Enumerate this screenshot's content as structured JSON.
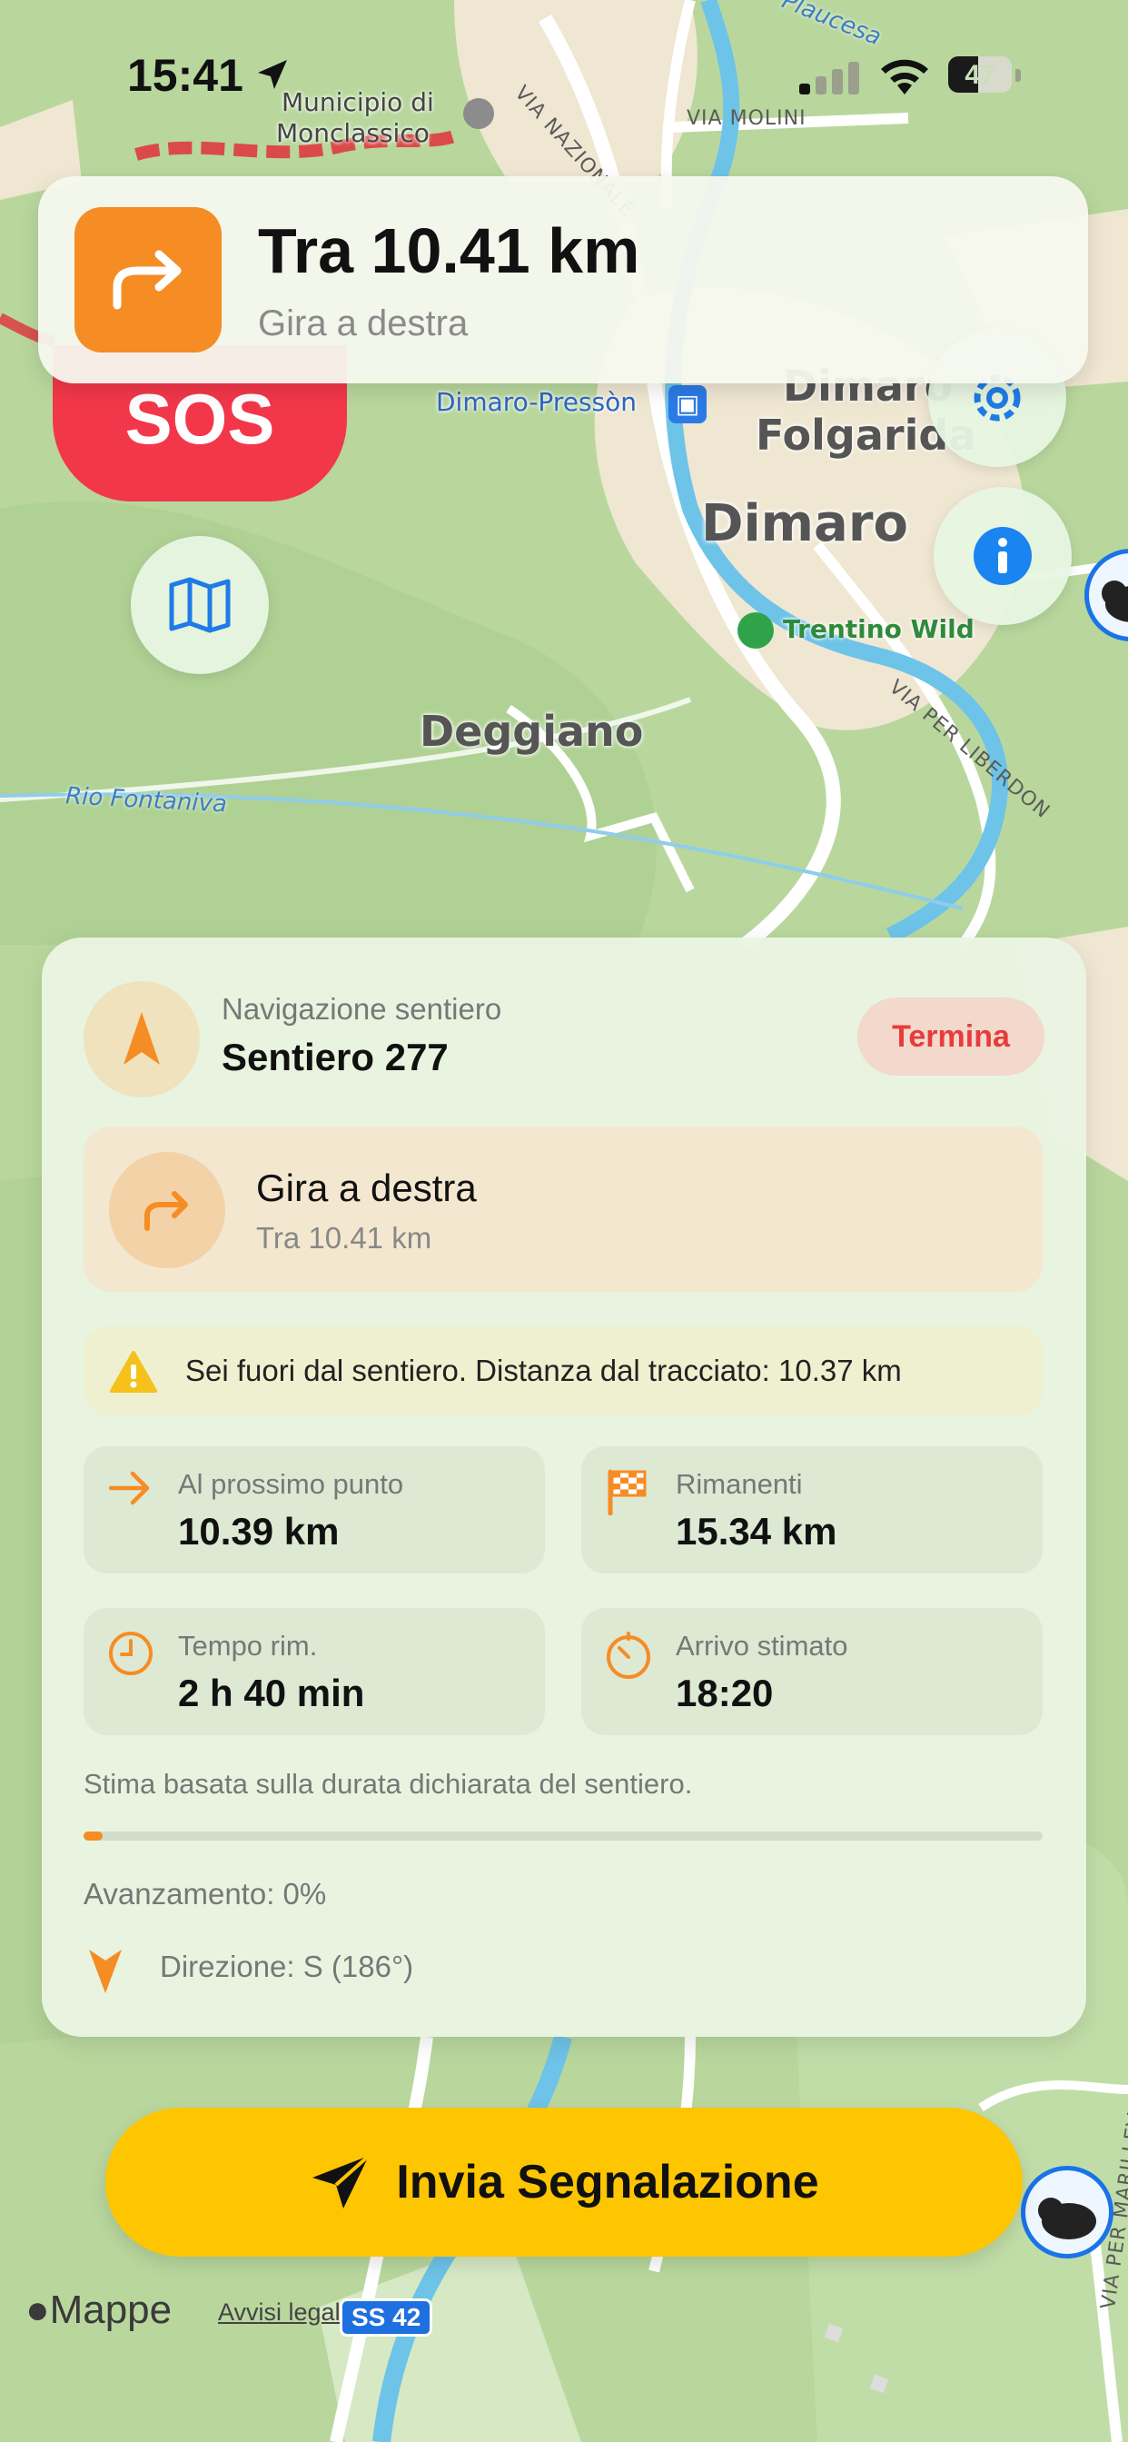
{
  "status_bar": {
    "time": "15:41",
    "battery": "47",
    "battery_level": 0.47
  },
  "map": {
    "labels": {
      "town_hall": "Municipio di",
      "town_hall_2": "Monclassico",
      "road_nazionale": "VIA NAZIONALE",
      "road_molini": "VIA MOLINI",
      "river_plaucesa": "Plaucesa",
      "station": "Dimaro-Pressòn",
      "folgarida_1": "Dimaro",
      "folgarida_2": "Folgarida",
      "dimaro": "Dimaro",
      "trentino_wild": "Trentino Wild",
      "road_liberdon": "VIA PER LIBERDON",
      "deggiano": "Deggiano",
      "rio_fontaniva": "Rio Fontaniva",
      "road_marilleva": "VIA PER MARILLEVA",
      "road_ss42": "SS 42"
    },
    "legal": {
      "logo": "Mappe",
      "link": "Avvisi legali"
    }
  },
  "banner": {
    "title": "Tra 10.41 km",
    "subtitle": "Gira a destra",
    "icon": "turn-right-icon"
  },
  "buttons": {
    "sos": "SOS"
  },
  "navigation": {
    "header_label": "Navigazione sentiero",
    "trail_name": "Sentiero 277",
    "end_button": "Termina",
    "instruction_title": "Gira a destra",
    "instruction_distance": "Tra 10.41 km",
    "warning": "Sei fuori dal sentiero. Distanza dal tracciato: 10.37 km",
    "stats": {
      "next_point_label": "Al prossimo punto",
      "next_point_value": "10.39 km",
      "remaining_label": "Rimanenti",
      "remaining_value": "15.34 km",
      "time_label": "Tempo rim.",
      "time_value": "2 h 40 min",
      "eta_label": "Arrivo stimato",
      "eta_value": "18:20"
    },
    "note": "Stima basata sulla durata dichiarata del sentiero.",
    "progress_fraction": 0.02,
    "progress_text": "Avanzamento: 0%",
    "direction_text": "Direzione: S (186°)"
  },
  "cta": {
    "label": "Invia Segnalazione",
    "icon": "send-icon"
  },
  "colors": {
    "accent": "#f68c24",
    "sos": "#f3374a",
    "cta": "#fec501",
    "map_water": "#6ec3e8"
  }
}
